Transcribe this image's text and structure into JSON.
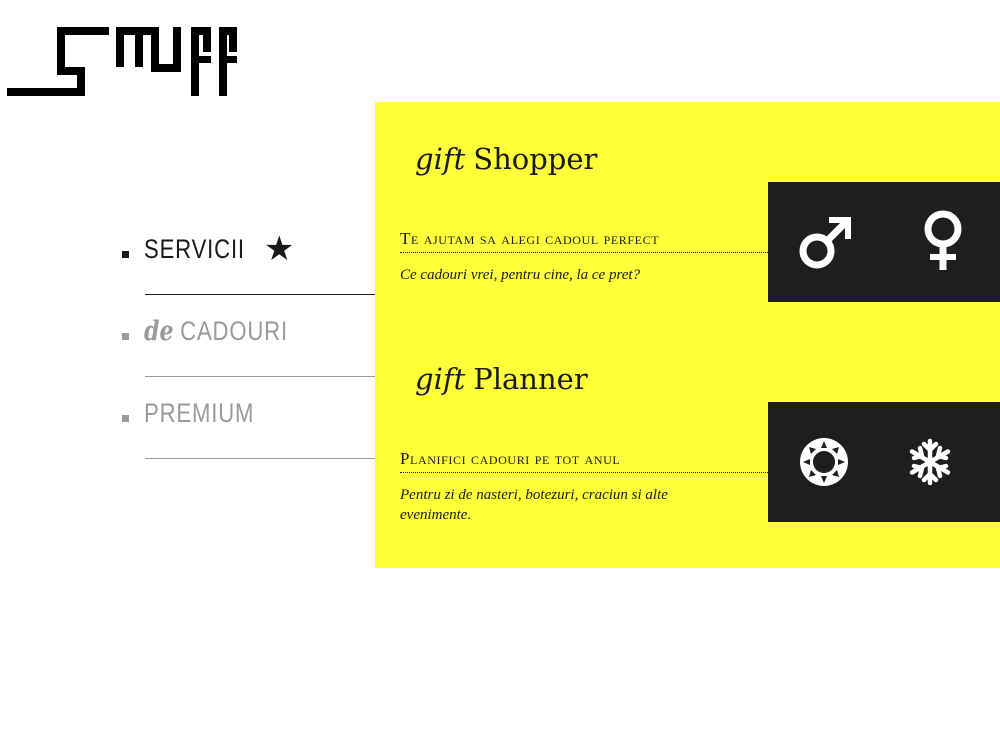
{
  "logo": {
    "icon": "smuff-logo"
  },
  "nav": {
    "items": [
      {
        "prefix": "",
        "label": "SERVICII",
        "active": true,
        "icon": "star-icon"
      },
      {
        "prefix": "de",
        "label": "CADOURI",
        "active": false
      },
      {
        "prefix": "",
        "label": "PREMIUM",
        "active": false
      }
    ]
  },
  "cards": [
    {
      "title_prefix": "gift",
      "title": "Shopper",
      "tagline": "Te ajutam sa alegi cadoul perfect",
      "description": "Ce cadouri vrei, pentru cine, la ce pret?",
      "icons": [
        "male-symbol-icon",
        "female-symbol-icon"
      ]
    },
    {
      "title_prefix": "gift",
      "title": "Planner",
      "tagline": "Planifici cadouri pe tot anul",
      "description": "Pentru zi de nasteri, botezuri, craciun si alte evenimente.",
      "icons": [
        "sun-icon",
        "snowflake-icon"
      ]
    }
  ],
  "colors": {
    "panel": "#ffff3a",
    "icon_box": "#1e1e1e",
    "inactive": "#9a9a9a"
  }
}
